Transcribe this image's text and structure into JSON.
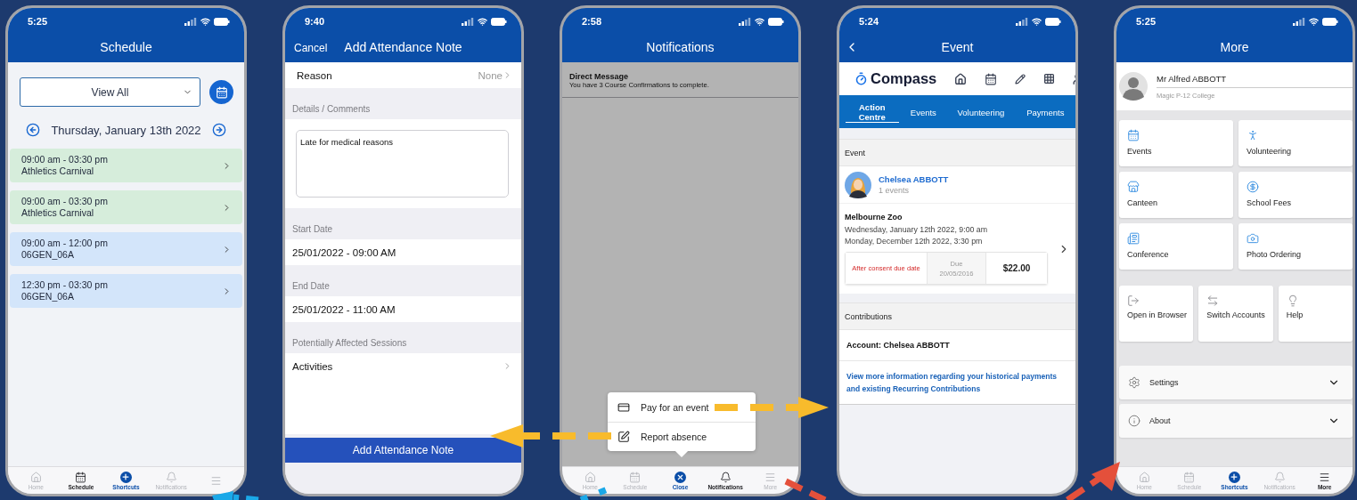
{
  "phones": [
    {
      "kind": "schedule",
      "time": "5:25",
      "title": "Schedule",
      "filter": "View All",
      "date": "Thursday, January 13th 2022",
      "entries": [
        {
          "time": "09:00 am - 03:30 pm",
          "title": "Athletics Carnival",
          "color": "#d6eddb"
        },
        {
          "time": "09:00 am - 03:30 pm",
          "title": "Athletics Carnival",
          "color": "#d6eddb"
        },
        {
          "time": "09:00 am - 12:00 pm",
          "title": "06GEN_06A",
          "color": "#d3e5fa"
        },
        {
          "time": "12:30 pm - 03:30 pm",
          "title": "06GEN_06A",
          "color": "#d3e5fa"
        }
      ],
      "tab_bar": [
        {
          "kind": "home",
          "label": "Home",
          "selected": false
        },
        {
          "kind": "calendar",
          "label": "Schedule",
          "selected": true
        },
        {
          "kind": "add",
          "label": "Shortcuts",
          "selected": false
        },
        {
          "kind": "bell",
          "label": "Notifications",
          "selected": false
        },
        {
          "kind": "menu",
          "selected": false
        }
      ]
    },
    {
      "kind": "form",
      "time": "9:40",
      "cancel": "Cancel",
      "title": "Add Attendance Note",
      "reason": {
        "label": "Reason",
        "value": "None"
      },
      "sections": [
        {
          "kind": "textarea",
          "label": "Details / Comments",
          "value": "Late for medical reasons"
        },
        {
          "kind": "value",
          "label": "Start Date",
          "value": "25/01/2022 - 09:00 AM"
        },
        {
          "kind": "value",
          "label": "End Date",
          "value": "25/01/2022 - 11:00 AM"
        },
        {
          "kind": "link",
          "label": "Potentially Affected Sessions",
          "value": "Activities"
        }
      ],
      "submit": "Add Attendance Note"
    },
    {
      "kind": "notifications",
      "time": "2:58",
      "title": "Notifications",
      "messages": [
        {
          "title": "Direct Message",
          "body": "You have 3 Course Confirmations to complete."
        }
      ],
      "menu": [
        {
          "kind": "card",
          "label": "Pay for an event"
        },
        {
          "kind": "edit",
          "label": "Report absence"
        }
      ],
      "tab_bar": [
        {
          "kind": "home",
          "label": "Home",
          "selected": false
        },
        {
          "kind": "calendar",
          "label": "Schedule",
          "selected": false
        },
        {
          "kind": "close",
          "label": "Close",
          "selected": false
        },
        {
          "kind": "bell",
          "label": "Notifications",
          "selected": true
        },
        {
          "kind": "menu",
          "label": "More",
          "selected": false
        }
      ]
    },
    {
      "kind": "event",
      "time": "5:24",
      "title": "Event",
      "brand": "Compass",
      "tabs": [
        {
          "label": "Action Centre",
          "selected": true
        },
        {
          "label": "Events",
          "selected": false
        },
        {
          "label": "Volunteering",
          "selected": false
        },
        {
          "label": "Payments",
          "selected": false
        }
      ],
      "section": "Event",
      "person": {
        "name": "Chelsea ABBOTT",
        "count": "1 events"
      },
      "event": {
        "name": "Melbourne Zoo",
        "start": "Wednesday, January 12th 2022, 9:00 am",
        "end": "Monday, December 12th 2022, 3:30 pm",
        "status": "After consent due date",
        "due_label": "Due",
        "due_date": "20/05/2016",
        "amount": "$22.00"
      },
      "contributions": {
        "title": "Contributions",
        "account": "Account: Chelsea ABBOTT",
        "link": "View more information regarding your historical payments and existing Recurring Contributions"
      }
    },
    {
      "kind": "more",
      "time": "5:25",
      "title": "More",
      "profile": {
        "name": "Mr Alfred ABBOTT",
        "school": "Magic P-12 College"
      },
      "tiles": [
        {
          "kind": "calendar",
          "label": "Events"
        },
        {
          "kind": "person",
          "label": "Volunteering"
        },
        {
          "kind": "store",
          "label": "Canteen"
        },
        {
          "kind": "coins",
          "label": "School Fees"
        },
        {
          "kind": "news",
          "label": "Conference"
        },
        {
          "kind": "camera",
          "label": "Photo Ordering"
        }
      ],
      "actions": [
        {
          "kind": "exit",
          "label": "Open in Browser"
        },
        {
          "kind": "swap",
          "label": "Switch Accounts"
        },
        {
          "kind": "bulb",
          "label": "Help"
        }
      ],
      "accordions": [
        {
          "kind": "gear",
          "label": "Settings",
          "expanded": false
        },
        {
          "kind": "info",
          "label": "About",
          "expanded": false
        }
      ],
      "tab_bar": [
        {
          "kind": "home",
          "label": "Home",
          "selected": false
        },
        {
          "kind": "calendar",
          "label": "Schedule",
          "selected": false
        },
        {
          "kind": "add",
          "label": "Shortcuts",
          "selected": false
        },
        {
          "kind": "bell",
          "label": "Notifications",
          "selected": false
        },
        {
          "kind": "menu",
          "label": "More",
          "selected": true
        }
      ]
    }
  ]
}
